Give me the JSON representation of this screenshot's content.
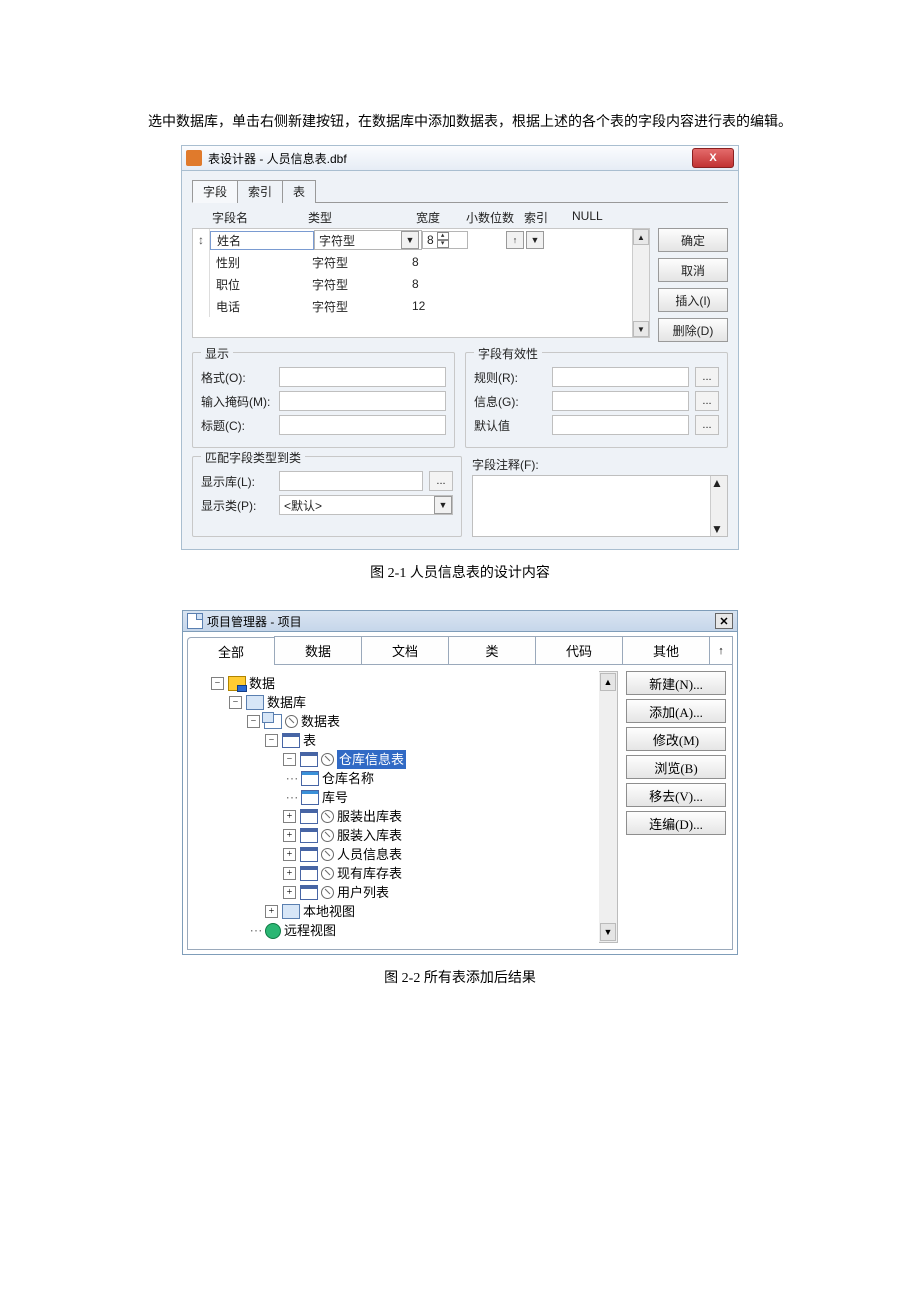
{
  "body_text": "选中数据库，单击右侧新建按钮，在数据库中添加数据表，根据上述的各个表的字段内容进行表的编辑。",
  "fig1": {
    "title": "表设计器 - 人员信息表.dbf",
    "tabs": [
      "字段",
      "索引",
      "表"
    ],
    "columns": {
      "name": "字段名",
      "type": "类型",
      "width": "宽度",
      "decimal": "小数位数",
      "index": "索引",
      "null": "NULL"
    },
    "rows": [
      {
        "name": "姓名",
        "type": "字符型",
        "width": "8",
        "selected": true
      },
      {
        "name": "性别",
        "type": "字符型",
        "width": "8"
      },
      {
        "name": "职位",
        "type": "字符型",
        "width": "8"
      },
      {
        "name": "电话",
        "type": "字符型",
        "width": "12"
      }
    ],
    "buttons": {
      "ok": "确定",
      "cancel": "取消",
      "insert": "插入(I)",
      "delete": "删除(D)"
    },
    "display": {
      "legend": "显示",
      "format": "格式(O):",
      "mask": "输入掩码(M):",
      "caption": "标题(C):"
    },
    "validity": {
      "legend": "字段有效性",
      "rule": "规则(R):",
      "msg": "信息(G):",
      "default": "默认值"
    },
    "map": {
      "legend": "匹配字段类型到类",
      "lib": "显示库(L):",
      "cls": "显示类(P):",
      "cls_val": "<默认>"
    },
    "comment_label": "字段注释(F):",
    "caption": "图 2-1 人员信息表的设计内容"
  },
  "fig2": {
    "title": "项目管理器 - 项目",
    "tabs": [
      "全部",
      "数据",
      "文档",
      "类",
      "代码",
      "其他"
    ],
    "tree": {
      "n0": "数据",
      "n1": "数据库",
      "n2": "数据表",
      "n3": "表",
      "n4": "仓库信息表",
      "n5": "仓库名称",
      "n6": "库号",
      "n7": "服装出库表",
      "n8": "服装入库表",
      "n9": "人员信息表",
      "n10": "现有库存表",
      "n11": "用户列表",
      "n12": "本地视图",
      "n13": "远程视图"
    },
    "buttons": {
      "new": "新建(N)...",
      "add": "添加(A)...",
      "modify": "修改(M)",
      "browse": "浏览(B)",
      "remove": "移去(V)...",
      "build": "连编(D)..."
    },
    "caption": "图 2-2 所有表添加后结果"
  }
}
